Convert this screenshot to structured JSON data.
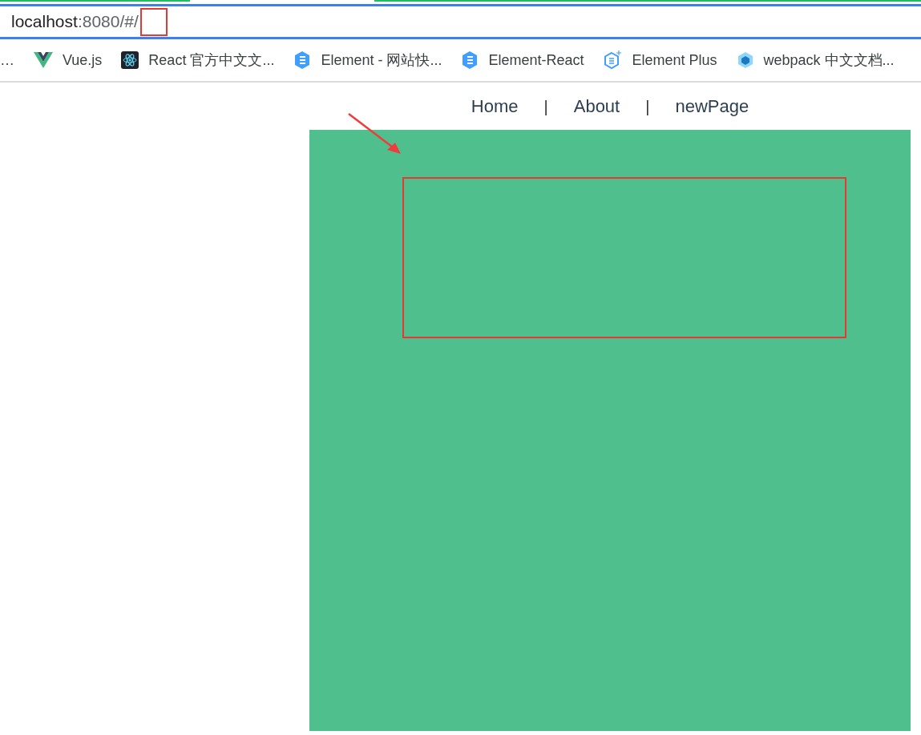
{
  "address_bar": {
    "host": "localhost",
    "rest": ":8080/#/"
  },
  "bookmarks": [
    {
      "label": "…",
      "kind": "none"
    },
    {
      "label": "Vue.js",
      "kind": "vue"
    },
    {
      "label": "React 官方中文文...",
      "kind": "react"
    },
    {
      "label": "Element - 网站快...",
      "kind": "element"
    },
    {
      "label": "Element-React",
      "kind": "element"
    },
    {
      "label": "Element Plus",
      "kind": "element-plus"
    },
    {
      "label": "webpack 中文文档...",
      "kind": "webpack"
    }
  ],
  "nav": [
    {
      "kind": "link",
      "label": "Home"
    },
    {
      "kind": "separator",
      "label": "|"
    },
    {
      "kind": "link",
      "label": "About"
    },
    {
      "kind": "separator",
      "label": "|"
    },
    {
      "kind": "link",
      "label": "newPage"
    }
  ]
}
